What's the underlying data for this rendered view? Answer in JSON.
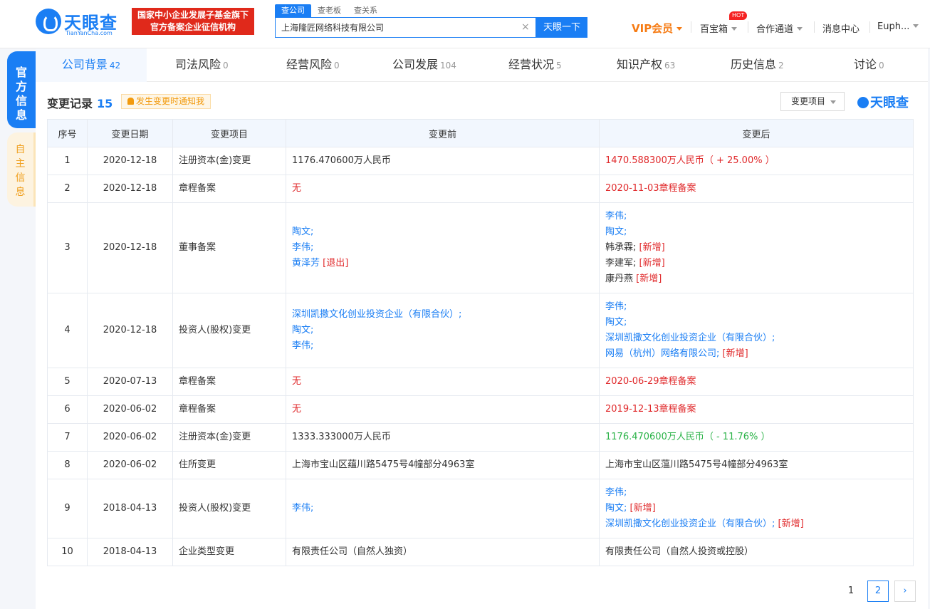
{
  "header": {
    "logo_cn": "天眼查",
    "logo_en": "TianYanCha.com",
    "badge_line1": "国家中小企业发展子基金旗下",
    "badge_line2": "官方备案企业征信机构",
    "search_tabs": [
      "查公司",
      "查老板",
      "查关系"
    ],
    "search_value": "上海隆匠网络科技有限公司",
    "search_button": "天眼一下",
    "nav": {
      "vip": "VIP会员",
      "box": "百宝箱",
      "hot": "HOT",
      "coop": "合作通道",
      "msg": "消息中心",
      "user": "Euph..."
    }
  },
  "sidebar": {
    "official": "官方信息",
    "self": "自主信息"
  },
  "tabs": [
    {
      "label": "公司背景",
      "count": "42"
    },
    {
      "label": "司法风险",
      "count": "0"
    },
    {
      "label": "经营风险",
      "count": "0"
    },
    {
      "label": "公司发展",
      "count": "104"
    },
    {
      "label": "经营状况",
      "count": "5"
    },
    {
      "label": "知识产权",
      "count": "63"
    },
    {
      "label": "历史信息",
      "count": "2"
    },
    {
      "label": "讨论",
      "count": "0"
    }
  ],
  "section": {
    "title": "变更记录",
    "count": "15",
    "notify": "发生变更时通知我",
    "filter": "变更项目",
    "brand": "天眼查"
  },
  "table": {
    "headers": [
      "序号",
      "变更日期",
      "变更项目",
      "变更前",
      "变更后"
    ],
    "rows": [
      {
        "no": "1",
        "date": "2020-12-18",
        "item": "注册资本(金)变更",
        "before": [
          {
            "t": "1176.470600万人民币",
            "c": ""
          }
        ],
        "after": [
          {
            "t": "1470.588300万人民币（ + 25.00% ）",
            "c": "red"
          }
        ]
      },
      {
        "no": "2",
        "date": "2020-12-18",
        "item": "章程备案",
        "before": [
          {
            "t": "无",
            "c": "red"
          }
        ],
        "after": [
          {
            "t": "2020-11-03章程备案",
            "c": "red"
          }
        ]
      },
      {
        "no": "3",
        "date": "2020-12-18",
        "item": "董事备案",
        "before": [
          {
            "t": "陶文;",
            "c": "blue"
          },
          {
            "t": "李伟;",
            "c": "blue"
          },
          {
            "t": "黄泽芳",
            "c": "blue",
            "tag": "[退出]"
          }
        ],
        "after": [
          {
            "t": "李伟;",
            "c": "blue"
          },
          {
            "t": "陶文;",
            "c": "blue"
          },
          {
            "t": "韩承霖;",
            "c": "",
            "tag": "[新增]"
          },
          {
            "t": "李建军;",
            "c": "",
            "tag": "[新增]"
          },
          {
            "t": "康丹燕",
            "c": "",
            "tag": "[新增]"
          }
        ]
      },
      {
        "no": "4",
        "date": "2020-12-18",
        "item": "投资人(股权)变更",
        "before": [
          {
            "t": "深圳凯撒文化创业投资企业（有限合伙）;",
            "c": "blue"
          },
          {
            "t": "陶文;",
            "c": "blue"
          },
          {
            "t": "李伟;",
            "c": "blue"
          }
        ],
        "after": [
          {
            "t": "李伟;",
            "c": "blue"
          },
          {
            "t": "陶文;",
            "c": "blue"
          },
          {
            "t": "深圳凯撒文化创业投资企业（有限合伙）;",
            "c": "blue"
          },
          {
            "t": "网易（杭州）网络有限公司;",
            "c": "blue",
            "tag": "[新增]"
          }
        ]
      },
      {
        "no": "5",
        "date": "2020-07-13",
        "item": "章程备案",
        "before": [
          {
            "t": "无",
            "c": "red"
          }
        ],
        "after": [
          {
            "t": "2020-06-29章程备案",
            "c": "red"
          }
        ]
      },
      {
        "no": "6",
        "date": "2020-06-02",
        "item": "章程备案",
        "before": [
          {
            "t": "无",
            "c": "red"
          }
        ],
        "after": [
          {
            "t": "2019-12-13章程备案",
            "c": "red"
          }
        ]
      },
      {
        "no": "7",
        "date": "2020-06-02",
        "item": "注册资本(金)变更",
        "before": [
          {
            "t": "1333.333000万人民币",
            "c": ""
          }
        ],
        "after": [
          {
            "t": "1176.470600万人民币（ - 11.76% ）",
            "c": "green"
          }
        ]
      },
      {
        "no": "8",
        "date": "2020-06-02",
        "item": "住所变更",
        "before": [
          {
            "t": "上海市宝山区蕴川路5475号4幢部分4963室",
            "c": ""
          }
        ],
        "after": [
          {
            "t": "上海市宝山区蕰川路5475号4幢部分4963室",
            "c": ""
          }
        ]
      },
      {
        "no": "9",
        "date": "2018-04-13",
        "item": "投资人(股权)变更",
        "before": [
          {
            "t": "李伟;",
            "c": "blue"
          }
        ],
        "after": [
          {
            "t": "李伟;",
            "c": "blue"
          },
          {
            "t": "陶文;",
            "c": "blue",
            "tag": "[新增]"
          },
          {
            "t": "深圳凯撒文化创业投资企业（有限合伙）;",
            "c": "blue",
            "tag": "[新增]"
          }
        ]
      },
      {
        "no": "10",
        "date": "2018-04-13",
        "item": "企业类型变更",
        "before": [
          {
            "t": "有限责任公司（自然人独资）",
            "c": ""
          }
        ],
        "after": [
          {
            "t": "有限责任公司（自然人投资或控股）",
            "c": ""
          }
        ]
      }
    ]
  },
  "pager": {
    "page1": "1",
    "page2": "2",
    "next": "›"
  },
  "colors": {
    "accent": "#1a7ef4",
    "red": "#e0292b",
    "green": "#2bb348",
    "vip": "#f67b13"
  }
}
